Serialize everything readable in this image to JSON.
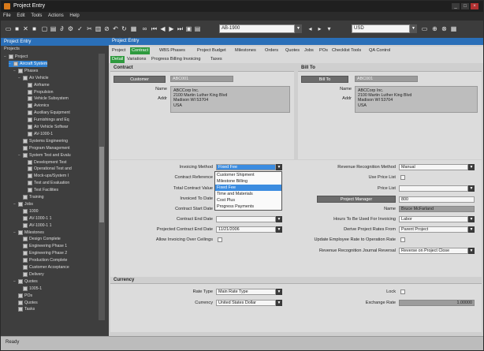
{
  "window": {
    "title": "Project Entry",
    "controls": [
      "_",
      "□",
      "×"
    ]
  },
  "menu": [
    "File",
    "Edit",
    "Tools",
    "Actions",
    "Help"
  ],
  "toolbar": {
    "project_field": "AB-1900",
    "currency_field": "USD"
  },
  "left_panel": {
    "header": "Project Entry",
    "sub": "Projects",
    "tree": [
      {
        "label": "Project",
        "level": 0,
        "exp": "−"
      },
      {
        "label": "Aircraft System",
        "level": 1,
        "exp": "−",
        "selected": true
      },
      {
        "label": "Phases",
        "level": 2,
        "exp": "−"
      },
      {
        "label": "Air Vehicle",
        "level": 3,
        "exp": "−"
      },
      {
        "label": "Airframe",
        "level": 4,
        "exp": ""
      },
      {
        "label": "Propulsion",
        "level": 4,
        "exp": ""
      },
      {
        "label": "Vehicle Subsystem",
        "level": 4,
        "exp": ""
      },
      {
        "label": "Avionics",
        "level": 4,
        "exp": ""
      },
      {
        "label": "Auxiliary Equipment",
        "level": 4,
        "exp": ""
      },
      {
        "label": "Furnishings and Eq",
        "level": 4,
        "exp": ""
      },
      {
        "label": "Air Vehicle Softwar",
        "level": 4,
        "exp": ""
      },
      {
        "label": "AV-1000-1",
        "level": 4,
        "exp": ""
      },
      {
        "label": "Systems Engineering",
        "level": 3,
        "exp": ""
      },
      {
        "label": "Program Management",
        "level": 3,
        "exp": ""
      },
      {
        "label": "System Test and Evalu",
        "level": 3,
        "exp": "−"
      },
      {
        "label": "Development Test",
        "level": 4,
        "exp": ""
      },
      {
        "label": "Operational Test and",
        "level": 4,
        "exp": ""
      },
      {
        "label": "Mock-ups/System I",
        "level": 4,
        "exp": ""
      },
      {
        "label": "Test and Evaluation",
        "level": 4,
        "exp": ""
      },
      {
        "label": "Test Facilities",
        "level": 4,
        "exp": ""
      },
      {
        "label": "Training",
        "level": 3,
        "exp": ""
      },
      {
        "label": "Jobs",
        "level": 2,
        "exp": "−"
      },
      {
        "label": "1000",
        "level": 3,
        "exp": ""
      },
      {
        "label": "AV-1000-1 1",
        "level": 3,
        "exp": ""
      },
      {
        "label": "AV-1000-1 1",
        "level": 3,
        "exp": ""
      },
      {
        "label": "Milestones",
        "level": 2,
        "exp": "−"
      },
      {
        "label": "Design Complete",
        "level": 3,
        "exp": ""
      },
      {
        "label": "Engineering Phase 1",
        "level": 3,
        "exp": ""
      },
      {
        "label": "Engineering Phase 2",
        "level": 3,
        "exp": ""
      },
      {
        "label": "Production Complete",
        "level": 3,
        "exp": ""
      },
      {
        "label": "Customer Acceptance",
        "level": 3,
        "exp": ""
      },
      {
        "label": "Delivery",
        "level": 3,
        "exp": ""
      },
      {
        "label": "Quotes",
        "level": 2,
        "exp": "−"
      },
      {
        "label": "1005-1",
        "level": 3,
        "exp": ""
      },
      {
        "label": "POs",
        "level": 2,
        "exp": ""
      },
      {
        "label": "Quotes",
        "level": 2,
        "exp": ""
      },
      {
        "label": "Tasks",
        "level": 2,
        "exp": ""
      }
    ]
  },
  "main": {
    "header": "Project Entry",
    "tabs": [
      "Project",
      "Contract",
      "WBS Phases",
      "Project Budget",
      "Milestones",
      "Orders",
      "Quotes",
      "Jobs",
      "POs",
      "Checklist Tools",
      "QA Control"
    ],
    "active_tab": 1,
    "subtabs": [
      "Detail",
      "Variations",
      "Progress Billing Invoicing",
      "Taxes"
    ],
    "active_subtab": 0,
    "contract": {
      "header": "Contract",
      "customer_btn": "Customer",
      "customer_val": "ABC001",
      "name_label": "Name",
      "addr_label": "Addr",
      "address": [
        "ABCCorp Inc.",
        "2100 Martin Luther King Blvd",
        "Madison WI 53704",
        "USA"
      ]
    },
    "billto": {
      "header": "Bill To",
      "btn": "Bill To",
      "val": "ABC001",
      "name_label": "Name",
      "addr_label": "Addr",
      "address": [
        "ABCCorp Inc.",
        "2100 Martin Luther King Blvd",
        "Madison WI 53704",
        "USA"
      ]
    },
    "fields": {
      "invoicing_method_label": "Invoicing Method",
      "invoicing_method_value": "Fixed Fee",
      "contract_reference_label": "Contract Reference",
      "total_contract_value_label": "Total Contract Value",
      "invoiced_to_date_label": "Invoiced To Date",
      "contract_start_date_label": "Contract Start Date",
      "contract_end_date_label": "Contract End Date",
      "projected_end_date_label": "Projected Contract End Date",
      "projected_end_date_value": "11/21/2006",
      "allow_overrun_label": "Allow Invoicing Over Ceilings",
      "revenue_recognition_label": "Revenue Recognition Method",
      "revenue_recognition_value": "Manual",
      "use_price_list_label": "Use Price List",
      "price_list_label": "Price List",
      "project_manager_btn": "Project Manager",
      "project_manager_value": "800",
      "name_label": "Name",
      "name_value": "Bruce McFarland",
      "hours_invoicing_label": "Hours To Be Used For Invoicing",
      "hours_invoicing_value": "Labor",
      "derive_rates_label": "Derive Project Rates From",
      "derive_rates_value": "Parent Project",
      "update_employee_label": "Update Employee Rate to Operation Rate",
      "revenue_journal_label": "Revenue Recognition Journal Reversal",
      "revenue_journal_value": "Reverse on Project Close"
    },
    "dropdown_options": [
      "Customer Shipment",
      "Milestone Billing",
      "Fixed Fee",
      "Time and Materials",
      "Cost Plus",
      "Progress Payments"
    ],
    "dropdown_highlight": 2,
    "currency": {
      "header": "Currency",
      "rate_type_label": "Rate Type",
      "rate_type_value": "Main Rate Type",
      "currency_label": "Currency",
      "currency_value": "United States Dollar",
      "lock_label": "Lock",
      "exchange_rate_label": "Exchange Rate",
      "exchange_rate_value": "1.00000"
    }
  },
  "status": "Ready"
}
